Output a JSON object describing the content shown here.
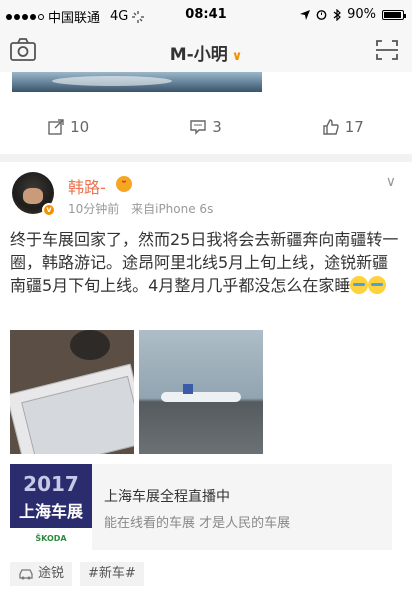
{
  "status_bar": {
    "carrier": "中国联通",
    "network": "4G",
    "time": "08:41",
    "battery": "90%"
  },
  "nav": {
    "title": "M-小明",
    "chevron": "∨"
  },
  "previous_post": {
    "actions": [
      {
        "icon": "repost-icon",
        "count": "10"
      },
      {
        "icon": "comment-icon",
        "count": "3"
      },
      {
        "icon": "like-icon",
        "count": "17"
      }
    ]
  },
  "post": {
    "username": "韩路-",
    "time": "10分钟前",
    "source": "来自iPhone 6s",
    "text": "终于车展回家了，然而25日我将会去新疆奔向南疆转一圈，韩路游记。途昂阿里北线5月上旬上线，途锐新疆南疆5月下旬上线。4月整月几乎都没怎么在家睡",
    "dropdown": "∨",
    "link_card": {
      "thumb_year": "2017",
      "thumb_text": "上海车展",
      "thumb_brand": "ŠKODA",
      "title": "上海车展全程直播中",
      "description": "能在线看的车展 才是人民的车展"
    },
    "tags": [
      "途锐",
      "#新车#"
    ]
  },
  "colors": {
    "accent": "#f29100",
    "username": "#eb7350"
  }
}
